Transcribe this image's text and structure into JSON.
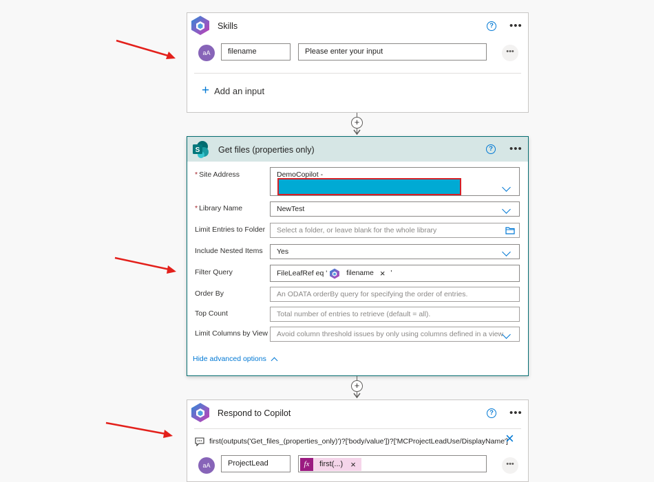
{
  "colors": {
    "accent": "#0078d4",
    "sharepoint_header_bg": "#d6e6e5",
    "sharepoint_border": "#036c70",
    "avatar": "#8764b8",
    "redacted_fill": "#00aad4",
    "redacted_border": "#d62027",
    "arrow_red": "#e3201b",
    "expression_token": "#f5d5ea"
  },
  "skills": {
    "title": "Skills",
    "help_icon": "?",
    "more_icon": "•••",
    "avatar_text": "aA",
    "input_name": "filename",
    "input_value": "Please enter your input",
    "row_more": "•••",
    "add_input_icon": "+",
    "add_input_label": "Add an input"
  },
  "connector": {
    "plus_icon": "+"
  },
  "get_files": {
    "icon_letter": "S",
    "title": "Get files (properties only)",
    "help_icon": "?",
    "more_icon": "•••",
    "fields": {
      "site_address": {
        "required_mark": "*",
        "label": "Site Address",
        "value": "DemoCopilot -"
      },
      "library_name": {
        "required_mark": "*",
        "label": "Library Name",
        "value": "NewTest"
      },
      "limit_entries": {
        "label": "Limit Entries to Folder",
        "placeholder": "Select a folder, or leave blank for the whole library"
      },
      "include_nested": {
        "label": "Include Nested Items",
        "value": "Yes"
      },
      "filter_query": {
        "label": "Filter Query",
        "prefix": "FileLeafRef eq '",
        "token": "filename",
        "token_remove": "×",
        "suffix": "'"
      },
      "order_by": {
        "label": "Order By",
        "placeholder": "An ODATA orderBy query for specifying the order of entries."
      },
      "top_count": {
        "label": "Top Count",
        "placeholder": "Total number of entries to retrieve (default = all)."
      },
      "limit_columns": {
        "label": "Limit Columns by View",
        "placeholder": "Avoid column threshold issues by only using columns defined in a view"
      }
    },
    "advanced_label": "Hide advanced options"
  },
  "respond": {
    "title": "Respond to Copilot",
    "help_icon": "?",
    "more_icon": "•••",
    "expression": "first(outputs('Get_files_(properties_only)')?['body/value'])?['MCProjectLeadUse/DisplayName']",
    "close_icon": "×",
    "avatar_text": "aA",
    "output_name": "ProjectLead",
    "fx_label": "fx",
    "token_label": "first(...)",
    "token_remove": "×",
    "row_more": "•••"
  }
}
